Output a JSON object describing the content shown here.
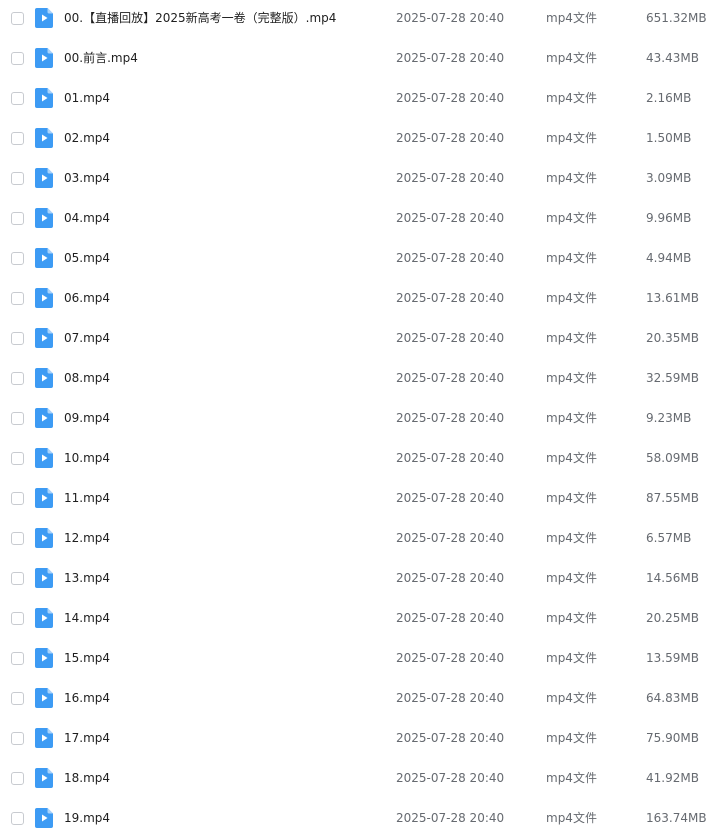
{
  "colors": {
    "icon_blue": "#3d9bf4",
    "icon_fold": "#a9d3fb",
    "checkbox_border": "#c8cbd0",
    "meta_text": "#666a70"
  },
  "icons": {
    "file": "video-file-icon"
  },
  "files": [
    {
      "name": "00.【直播回放】2025新高考一卷（完整版）.mp4",
      "date": "2025-07-28 20:40",
      "type": "mp4文件",
      "size": "651.32MB"
    },
    {
      "name": "00.前言.mp4",
      "date": "2025-07-28 20:40",
      "type": "mp4文件",
      "size": "43.43MB"
    },
    {
      "name": "01.mp4",
      "date": "2025-07-28 20:40",
      "type": "mp4文件",
      "size": "2.16MB"
    },
    {
      "name": "02.mp4",
      "date": "2025-07-28 20:40",
      "type": "mp4文件",
      "size": "1.50MB"
    },
    {
      "name": "03.mp4",
      "date": "2025-07-28 20:40",
      "type": "mp4文件",
      "size": "3.09MB"
    },
    {
      "name": "04.mp4",
      "date": "2025-07-28 20:40",
      "type": "mp4文件",
      "size": "9.96MB"
    },
    {
      "name": "05.mp4",
      "date": "2025-07-28 20:40",
      "type": "mp4文件",
      "size": "4.94MB"
    },
    {
      "name": "06.mp4",
      "date": "2025-07-28 20:40",
      "type": "mp4文件",
      "size": "13.61MB"
    },
    {
      "name": "07.mp4",
      "date": "2025-07-28 20:40",
      "type": "mp4文件",
      "size": "20.35MB"
    },
    {
      "name": "08.mp4",
      "date": "2025-07-28 20:40",
      "type": "mp4文件",
      "size": "32.59MB"
    },
    {
      "name": "09.mp4",
      "date": "2025-07-28 20:40",
      "type": "mp4文件",
      "size": "9.23MB"
    },
    {
      "name": "10.mp4",
      "date": "2025-07-28 20:40",
      "type": "mp4文件",
      "size": "58.09MB"
    },
    {
      "name": "11.mp4",
      "date": "2025-07-28 20:40",
      "type": "mp4文件",
      "size": "87.55MB"
    },
    {
      "name": "12.mp4",
      "date": "2025-07-28 20:40",
      "type": "mp4文件",
      "size": "6.57MB"
    },
    {
      "name": "13.mp4",
      "date": "2025-07-28 20:40",
      "type": "mp4文件",
      "size": "14.56MB"
    },
    {
      "name": "14.mp4",
      "date": "2025-07-28 20:40",
      "type": "mp4文件",
      "size": "20.25MB"
    },
    {
      "name": "15.mp4",
      "date": "2025-07-28 20:40",
      "type": "mp4文件",
      "size": "13.59MB"
    },
    {
      "name": "16.mp4",
      "date": "2025-07-28 20:40",
      "type": "mp4文件",
      "size": "64.83MB"
    },
    {
      "name": "17.mp4",
      "date": "2025-07-28 20:40",
      "type": "mp4文件",
      "size": "75.90MB"
    },
    {
      "name": "18.mp4",
      "date": "2025-07-28 20:40",
      "type": "mp4文件",
      "size": "41.92MB"
    },
    {
      "name": "19.mp4",
      "date": "2025-07-28 20:40",
      "type": "mp4文件",
      "size": "163.74MB"
    }
  ]
}
